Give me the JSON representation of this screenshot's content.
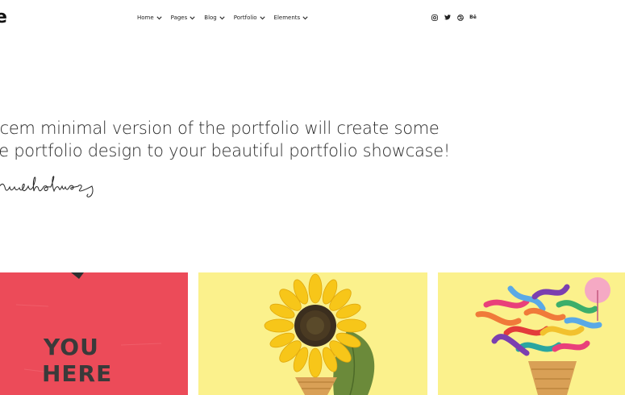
{
  "header": {
    "logo": "e",
    "nav": [
      {
        "label": "Home"
      },
      {
        "label": "Pages"
      },
      {
        "label": "Blog"
      },
      {
        "label": "Portfolio"
      },
      {
        "label": "Elements"
      }
    ],
    "social": [
      {
        "icon": "instagram-icon"
      },
      {
        "icon": "twitter-icon"
      },
      {
        "icon": "dribbble-icon"
      },
      {
        "icon": "behance-icon",
        "label": "Bē"
      }
    ]
  },
  "intro": {
    "lines": [
      "acem minimal version of the portfolio will create some",
      "ce portfolio design to your beautiful portfolio showcase!"
    ],
    "signature": "lucnholmes"
  },
  "portfolio": [
    {
      "image": "red-wall-you-here",
      "text_lines": [
        "YOU",
        "HERE"
      ],
      "color": "#ef4f5c"
    },
    {
      "image": "sunflower-ice-cream-cone",
      "color": "#fbf18c"
    },
    {
      "image": "ribbon-bouquet-cone",
      "color": "#fbf18c"
    }
  ],
  "colors": {
    "text": "#2a2a2a",
    "background": "#ffffff",
    "accent_red": "#ef4f5c",
    "accent_yellow": "#fbf18c"
  }
}
